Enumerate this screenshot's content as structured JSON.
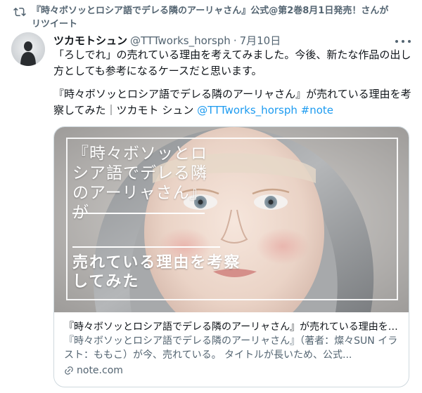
{
  "retweet": {
    "icon": "retweet-icon",
    "text": "『時々ボソッとロシア語でデレる隣のアーリャさん』公式@第2巻8月1日発売！さんがリツイート"
  },
  "author": {
    "avatar": "avatar",
    "display_name": "ツカモトシュン",
    "handle": "@TTTworks_horsph",
    "separator": "·",
    "date": "7月10日"
  },
  "more_icon": "more-icon",
  "body": {
    "paragraph1": "「ろしでれ」の売れている理由を考えてみました。今後、新たな作品の出し方としても参考になるケースだと思います。",
    "paragraph2_text": "『時々ボソッとロシア語でデレる隣のアーリャさん』が売れている理由を考察してみた｜ツカモト シュン ",
    "mention": "@TTTworks_horsph",
    "hashtag": "#note"
  },
  "card": {
    "overlay_title": "『時々ボソッとロシア語でデレる隣のアーリャさん』が",
    "overlay_subtitle": "売れている理由を考察してみた",
    "title": "『時々ボソッとロシア語でデレる隣のアーリャさん』が売れている理由を考察してみた",
    "description": "『時々ボソッとロシア語でデレる隣のアーリャさん』（著者：燦々SUN イラスト：ももこ）が今、売れている。 タイトルが長いため、公式...",
    "domain": "note.com",
    "domain_icon": "link-icon"
  },
  "colors": {
    "link": "#1d9bf0",
    "secondary": "#536471",
    "border": "#cfd9de"
  }
}
